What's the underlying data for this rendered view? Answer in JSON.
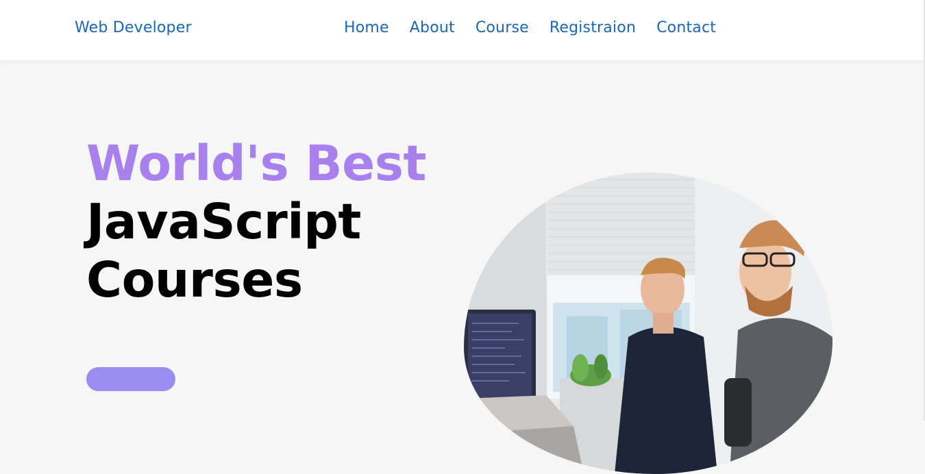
{
  "header": {
    "brand": "Web Developer",
    "nav": [
      "Home",
      "About",
      "Course",
      "Registraion",
      "Contact"
    ]
  },
  "hero": {
    "title_line1": "World's Best",
    "title_line2": "JavaScript",
    "title_line3": "Courses",
    "button_label": "",
    "image_alt": "two developers working at laptops"
  },
  "colors": {
    "accent": "#a881ee",
    "link": "#1a67b8",
    "button": "#9b8cf2",
    "background": "#f6f6f6"
  }
}
